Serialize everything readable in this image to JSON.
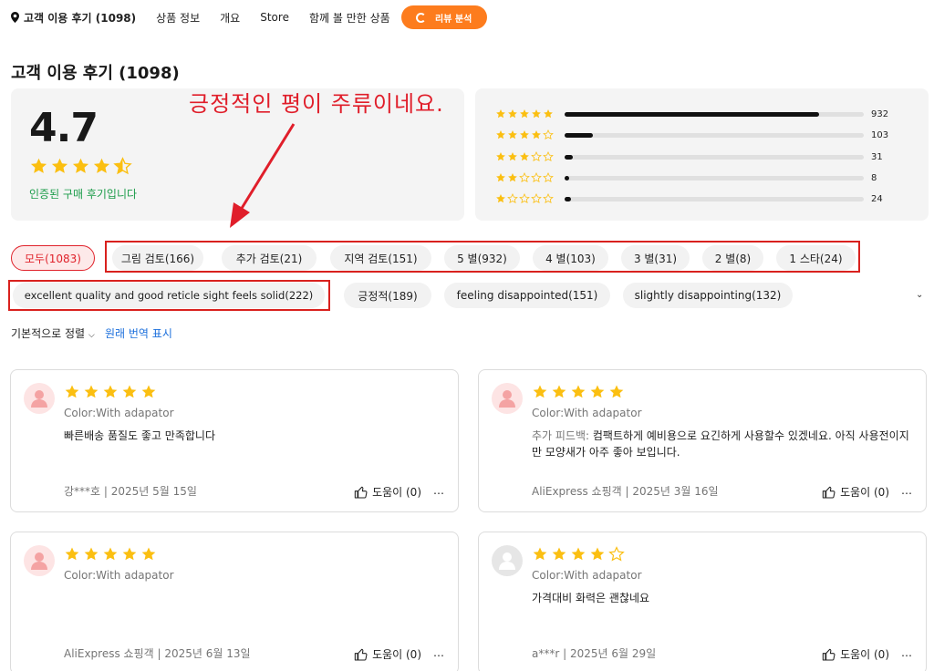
{
  "nav": {
    "reviews": "고객 이용 후기 (1098)",
    "product_info": "상품 정보",
    "overview": "개요",
    "store": "Store",
    "recommended": "함께 볼 만한 상품",
    "analysis_btn": "리뷰 분석"
  },
  "page_title": "고객 이용 후기 (1098)",
  "summary": {
    "rating": "4.7",
    "rating_value": 4.7,
    "verified": "인증된 구매 후기입니다",
    "distribution": [
      {
        "stars": 5,
        "count": "932",
        "fraction": 0.85
      },
      {
        "stars": 4,
        "count": "103",
        "fraction": 0.095
      },
      {
        "stars": 3,
        "count": "31",
        "fraction": 0.028
      },
      {
        "stars": 2,
        "count": "8",
        "fraction": 0.008
      },
      {
        "stars": 1,
        "count": "24",
        "fraction": 0.022
      }
    ]
  },
  "annotation": "긍정적인 평이 주류이네요.",
  "filters": {
    "all": "모두(1083)",
    "photo": "그림 검토(166)",
    "additional": "추가 검토(21)",
    "local": "지역 검토(151)",
    "five": "5 별(932)",
    "four": "4 별(103)",
    "three": "3 별(31)",
    "two": "2 별(8)",
    "one": "1 스타(24)",
    "tag1": "excellent quality and good reticle sight feels solid(222)",
    "tag2": "긍정적(189)",
    "tag3": "feeling disappointed(151)",
    "tag4": "slightly disappointing(132)"
  },
  "sort_label": "기본적으로 정렬",
  "translate_label": "원래 번역 표시",
  "reviews": [
    {
      "stars": 5,
      "variant": "Color:With adapator",
      "label": "",
      "text": "빠른배송 품질도 좋고 만족합니다",
      "meta": "강***호 | 2025년 5월 15일",
      "helpful": "도움이 (0)",
      "avatar": "pink"
    },
    {
      "stars": 5,
      "variant": "Color:With adapator",
      "label": "추가 피드백: ",
      "text": "컴팩트하게 예비용으로 요긴하게 사용할수 있겠네요. 아직 사용전이지만 모양새가 아주 좋아 보입니다.",
      "meta": "AliExpress 쇼핑객 | 2025년 3월 16일",
      "helpful": "도움이 (0)",
      "avatar": "pink"
    },
    {
      "stars": 5,
      "variant": "Color:With adapator",
      "label": "",
      "text": "",
      "meta": "AliExpress 쇼핑객 | 2025년 6월 13일",
      "helpful": "도움이 (0)",
      "avatar": "pink"
    },
    {
      "stars": 4,
      "variant": "Color:With adapator",
      "label": "",
      "text": "가격대비 화력은 괜찮네요",
      "meta": "a***r | 2025년 6월 29일",
      "helpful": "도움이 (0)",
      "avatar": "gray"
    }
  ],
  "colors": {
    "accent": "#fd7c1d",
    "star": "#fbbf11",
    "red": "#e0222b",
    "annotation": "#e01e2a"
  }
}
